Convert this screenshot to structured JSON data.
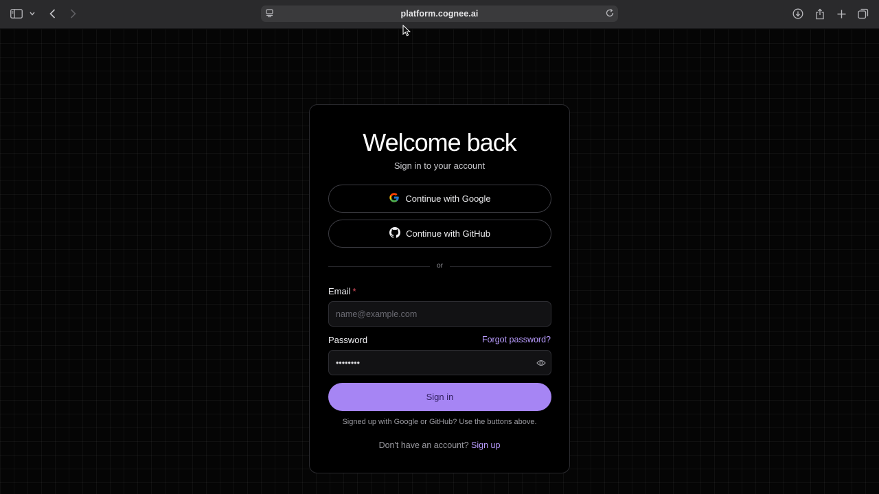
{
  "browser": {
    "url": "platform.cognee.ai",
    "icons": [
      "sidebar-icon",
      "chevron-down-icon",
      "back-arrow-icon",
      "forward-arrow-icon",
      "site-settings-icon",
      "reload-icon",
      "download-icon",
      "share-icon",
      "plus-icon",
      "tabs-overview-icon"
    ]
  },
  "login": {
    "title": "Welcome back",
    "subtitle": "Sign in to your account",
    "google_label": "Continue with Google",
    "github_label": "Continue with GitHub",
    "divider_text": "or",
    "email_label": "Email",
    "email_required_marker": "*",
    "email_placeholder": "name@example.com",
    "email_value": "",
    "password_label": "Password",
    "forgot_label": "Forgot password?",
    "password_value": "••••••••",
    "signin_label": "Sign in",
    "oauth_note": "Signed up with Google or GitHub? Use the buttons above.",
    "no_account_text": "Don't have an account?",
    "signup_label": "Sign up"
  },
  "colors": {
    "accent": "#a685f4",
    "link": "#b99cff",
    "required": "#e04f5f",
    "background": "#000000"
  }
}
